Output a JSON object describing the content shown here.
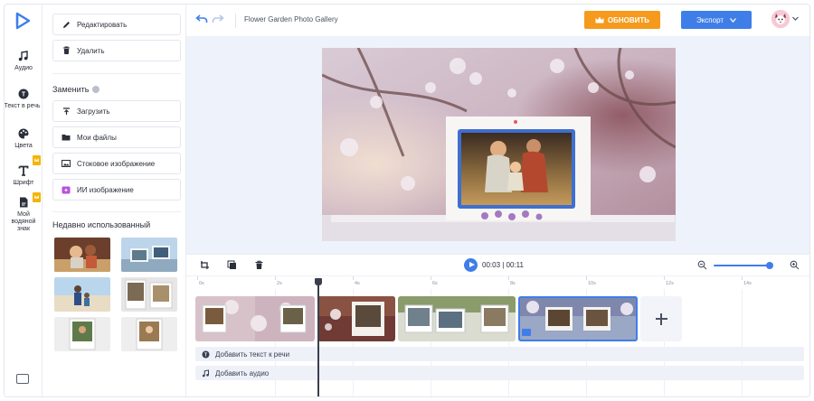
{
  "rail": {
    "items": [
      {
        "label": "Аудио",
        "icon": "music-note-icon"
      },
      {
        "label": "Текст в речь",
        "icon": "text-to-speech-icon"
      },
      {
        "label": "Цвета",
        "icon": "palette-icon"
      },
      {
        "label": "Шрифт",
        "icon": "font-icon",
        "premium": true
      },
      {
        "label": "Мой водяной знак",
        "icon": "watermark-icon",
        "premium": true
      }
    ]
  },
  "panel": {
    "edit_label": "Редактировать",
    "delete_label": "Удалить",
    "replace_heading": "Заменить",
    "upload_label": "Загрузить",
    "my_files_label": "Мои файлы",
    "stock_label": "Стоковое изображение",
    "ai_label": "ИИ изображение",
    "recent_heading": "Недавно использованный"
  },
  "header": {
    "title": "Flower Garden Photo Gallery",
    "upgrade_label": "ОБНОВИТЬ",
    "export_label": "Экспорт"
  },
  "playback": {
    "timecode": "00:03 | 00:11",
    "zoom_level": 0.97
  },
  "timeline": {
    "ticks": [
      "0s",
      "2s",
      "4s",
      "6s",
      "8s",
      "10s",
      "12s",
      "14s"
    ],
    "add_tts_label": "Добавить текст к речи",
    "add_audio_label": "Добавить аудио"
  },
  "colors": {
    "accent": "#3f7ee8",
    "upgrade": "#f59a1c",
    "premium_badge": "#f4b400"
  }
}
